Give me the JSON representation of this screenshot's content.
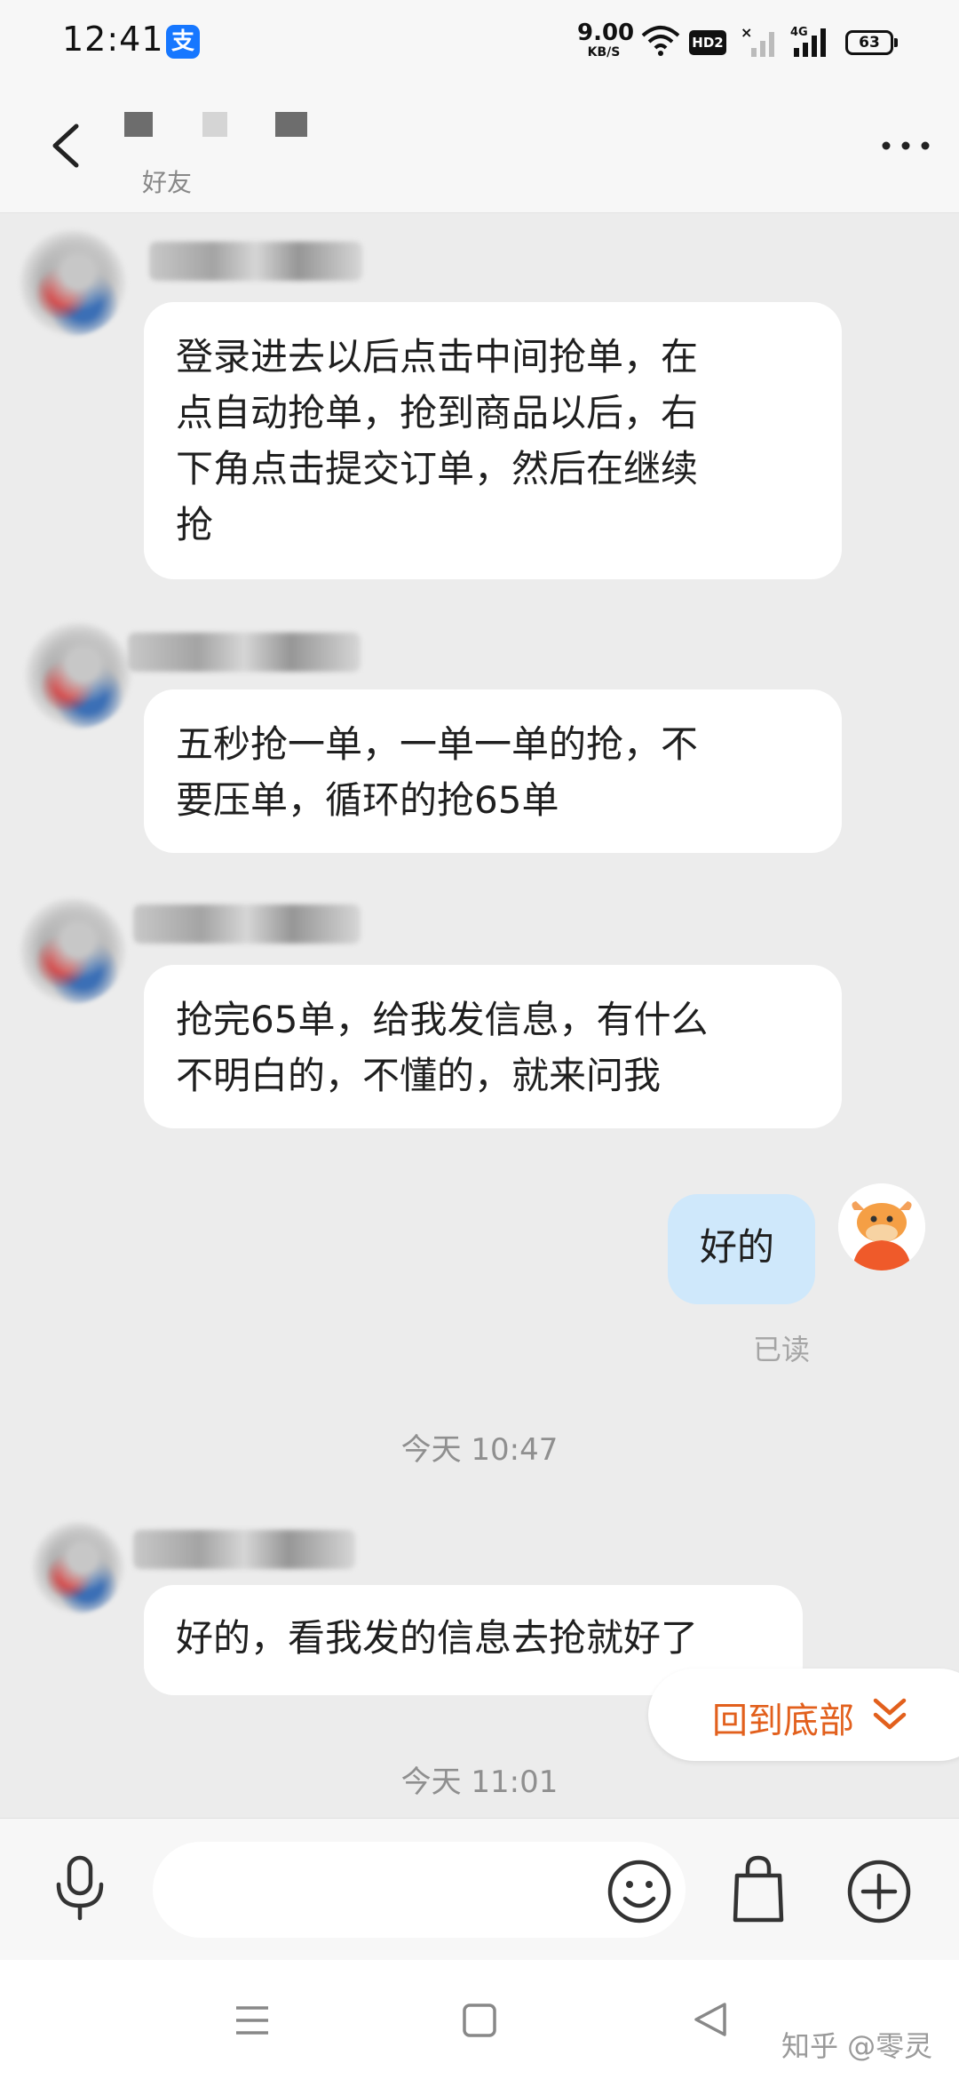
{
  "status_bar": {
    "time": "12:41",
    "app_glyph": "支",
    "net_speed": "9.00",
    "net_speed_unit": "KB/S",
    "hd_label": "HD2",
    "network_label": "4G",
    "battery": "63"
  },
  "header": {
    "subtitle": "好友"
  },
  "messages": [
    {
      "from": "other",
      "text": "登录进去以后点击中间抢单，在\n点自动抢单，抢到商品以后，右\n下角点击提交订单，然后在继续\n抢"
    },
    {
      "from": "other",
      "text": "五秒抢一单，一单一单的抢，不\n要压单，循环的抢65单"
    },
    {
      "from": "other",
      "text": "抢完65单，给我发信息，有什么\n不明白的，不懂的，就来问我"
    },
    {
      "from": "me",
      "text": "好的",
      "status": "已读"
    },
    {
      "type": "time",
      "text": "今天 10:47"
    },
    {
      "from": "other",
      "text": "好的，看我发的信息去抢就好了"
    },
    {
      "type": "time",
      "text": "今天 11:01"
    }
  ],
  "jump_button": {
    "label": "回到底部"
  },
  "input": {
    "placeholder": ""
  },
  "watermark": "知乎 @零灵",
  "colors": {
    "accent": "#e2601d",
    "my_bubble": "#cfe8fb",
    "bubble": "#ffffff",
    "background": "#ececec"
  },
  "icons": [
    "back-arrow-icon",
    "more-icon",
    "mic-icon",
    "emoji-icon",
    "shopping-bag-icon",
    "plus-icon",
    "chevron-double-down-icon",
    "menu-icon",
    "home-square-icon",
    "back-triangle-icon",
    "wifi-icon",
    "signal-icon"
  ]
}
